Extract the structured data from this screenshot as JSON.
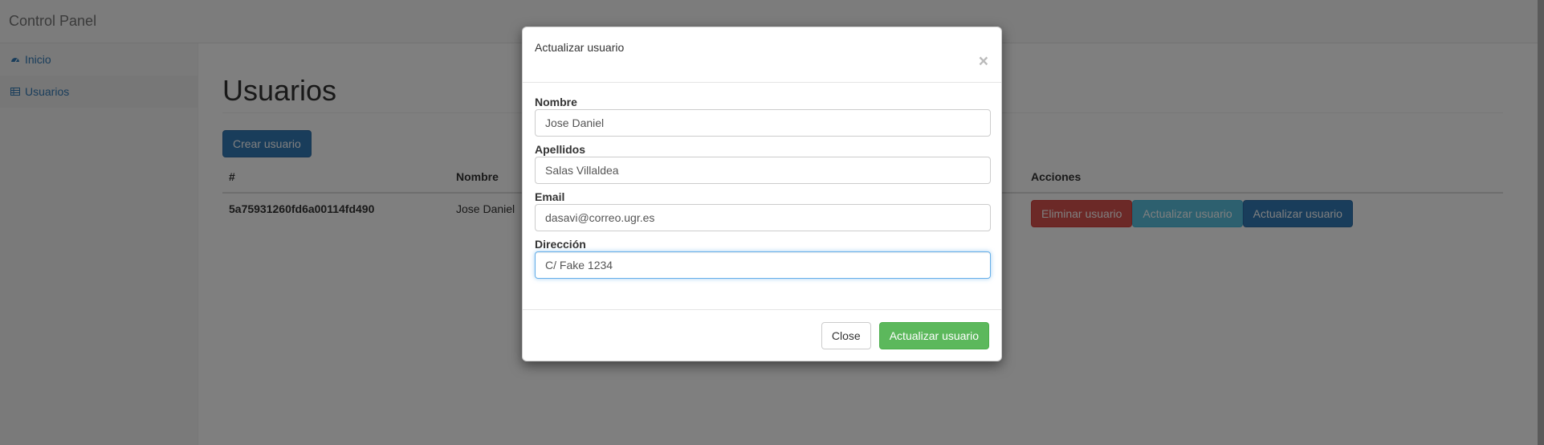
{
  "navbar": {
    "brand": "Control Panel"
  },
  "sidebar": {
    "items": [
      {
        "label": "Inicio",
        "icon": "dashboard-icon"
      },
      {
        "label": "Usuarios",
        "icon": "table-icon"
      }
    ]
  },
  "main": {
    "title": "Usuarios",
    "create_button": "Crear usuario",
    "table": {
      "headers": [
        "#",
        "Nombre",
        "Acciones"
      ],
      "rows": [
        {
          "id": "5a75931260fd6a00114fd490",
          "nombre": "Jose Daniel",
          "actions": [
            "Eliminar usuario",
            "Actualizar usuario",
            "Actualizar usuario"
          ]
        }
      ]
    }
  },
  "modal": {
    "title": "Actualizar usuario",
    "close_glyph": "×",
    "fields": [
      {
        "label": "Nombre",
        "value": "Jose Daniel"
      },
      {
        "label": "Apellidos",
        "value": "Salas Villaldea"
      },
      {
        "label": "Email",
        "value": "dasavi@correo.ugr.es"
      },
      {
        "label": "Dirección",
        "value": "C/ Fake 1234"
      }
    ],
    "close_button": "Close",
    "submit_button": "Actualizar usuario"
  },
  "colors": {
    "primary": "#337ab7",
    "danger": "#d9534f",
    "info": "#5bc0de",
    "success": "#5cb85c"
  }
}
